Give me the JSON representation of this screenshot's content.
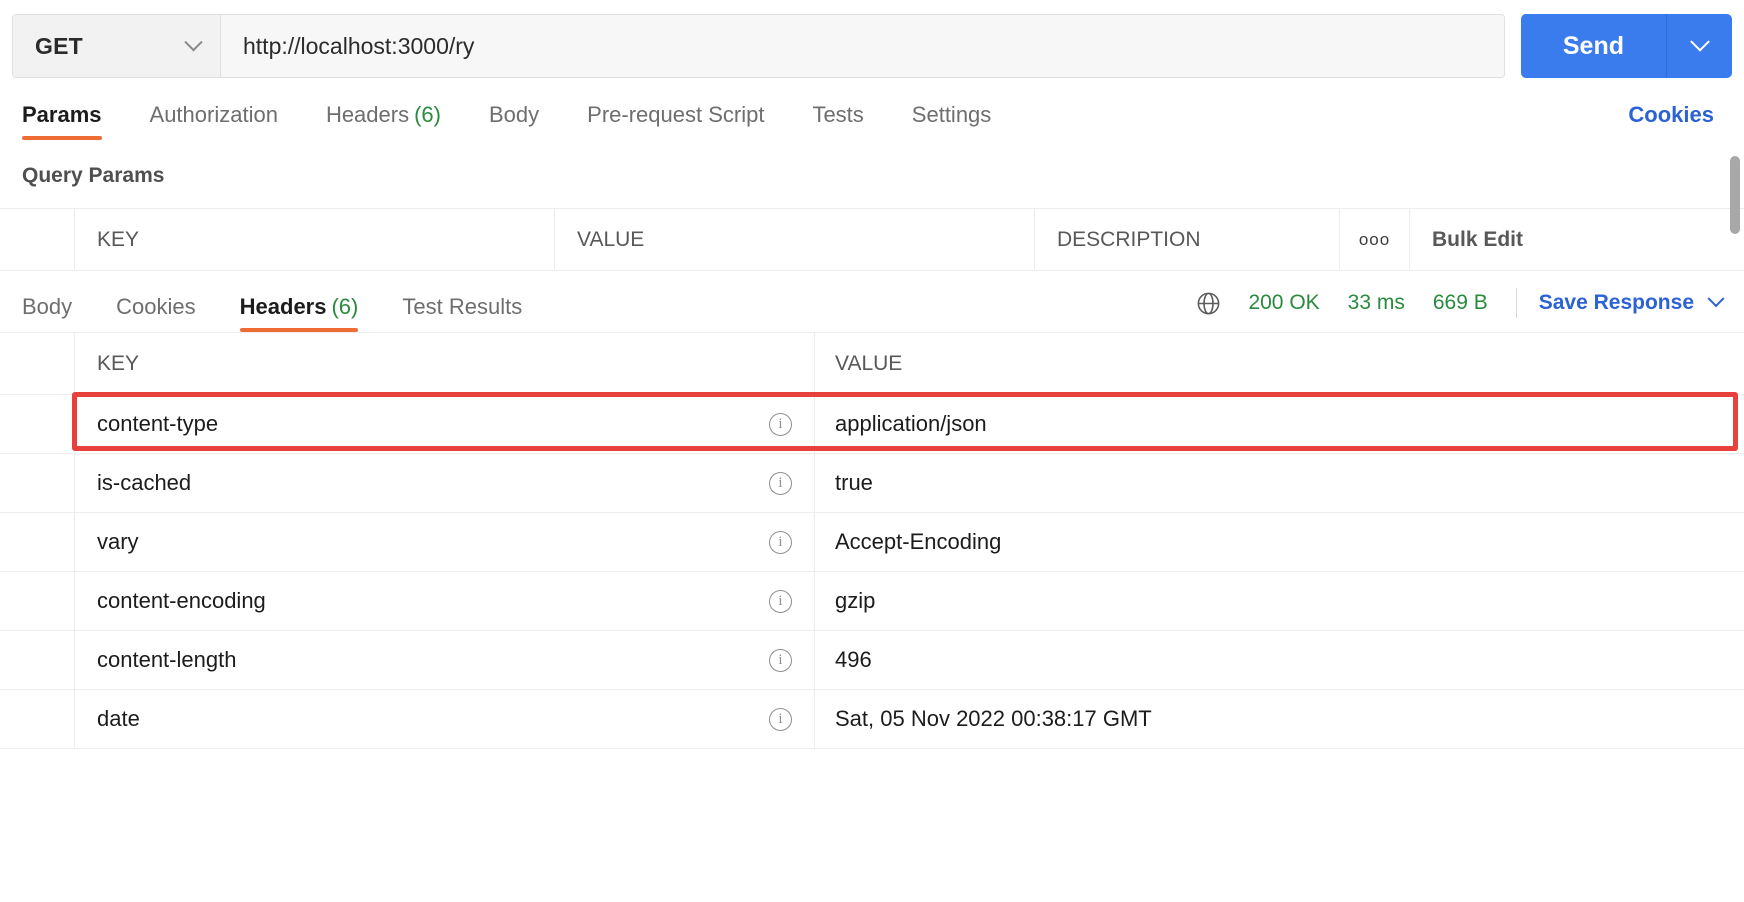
{
  "request": {
    "method": "GET",
    "method_icon": "chevron-down-icon",
    "url_value": "http://localhost:3000/ry",
    "url_placeholder": "Enter request URL",
    "send_label": "Send",
    "send_caret_icon": "chevron-down-icon",
    "tabs": [
      {
        "label": "Params",
        "count": "",
        "active": true
      },
      {
        "label": "Authorization",
        "count": "",
        "active": false
      },
      {
        "label": "Headers",
        "count": "(6)",
        "active": false
      },
      {
        "label": "Body",
        "count": "",
        "active": false
      },
      {
        "label": "Pre-request Script",
        "count": "",
        "active": false
      },
      {
        "label": "Tests",
        "count": "",
        "active": false
      },
      {
        "label": "Settings",
        "count": "",
        "active": false
      }
    ],
    "cookies_link": "Cookies"
  },
  "query_params": {
    "title": "Query Params",
    "columns": {
      "key": "KEY",
      "value": "VALUE",
      "description": "DESCRIPTION",
      "more_icon": "ooo",
      "bulk_edit": "Bulk Edit"
    }
  },
  "response": {
    "tabs": [
      {
        "label": "Body",
        "count": "",
        "active": false
      },
      {
        "label": "Cookies",
        "count": "",
        "active": false
      },
      {
        "label": "Headers",
        "count": "(6)",
        "active": true
      },
      {
        "label": "Test Results",
        "count": "",
        "active": false
      }
    ],
    "status": {
      "globe_icon": "globe-icon",
      "code": "200 OK",
      "time": "33 ms",
      "size": "669 B"
    },
    "save_response": "Save Response",
    "save_response_icon": "chevron-down-icon",
    "headers_columns": {
      "key": "KEY",
      "value": "VALUE"
    },
    "headers": [
      {
        "key": "content-type",
        "value": "application/json",
        "highlighted": false
      },
      {
        "key": "is-cached",
        "value": "true",
        "highlighted": true
      },
      {
        "key": "vary",
        "value": "Accept-Encoding",
        "highlighted": false
      },
      {
        "key": "content-encoding",
        "value": "gzip",
        "highlighted": false
      },
      {
        "key": "content-length",
        "value": "496",
        "highlighted": false
      },
      {
        "key": "date",
        "value": "Sat, 05 Nov 2022 00:38:17 GMT",
        "highlighted": false
      }
    ]
  },
  "colors": {
    "accent_orange": "#ef6c34",
    "link_blue": "#2b62d4",
    "send_blue": "#3a7bed",
    "status_green": "#2a8a3e",
    "highlight_red": "#e8403a"
  }
}
